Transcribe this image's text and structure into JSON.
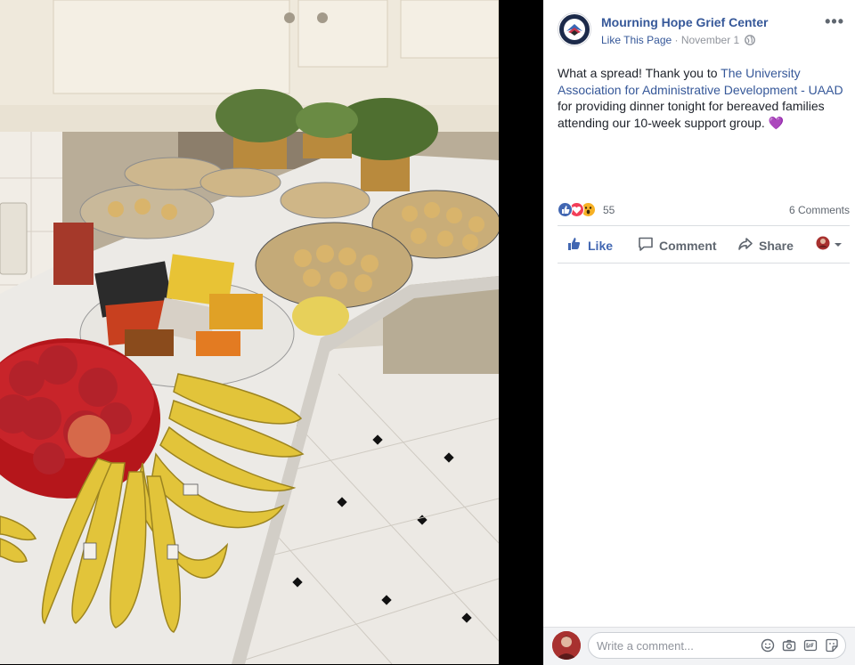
{
  "photo": {
    "alt_icon": "photo-of-food-spread"
  },
  "post": {
    "page_name": "Mourning Hope Grief Center",
    "like_this_page": "Like This Page",
    "separator": " · ",
    "date": "November 1",
    "audience_icon": "globe-icon",
    "more_icon": "•••",
    "text_before_link": "What a spread! Thank you to ",
    "link_text": "The University Association for Administrative Development - UAAD",
    "text_after_link": " for providing dinner tonight for bereaved families attending our 10-week support group. ",
    "emoji": "💜"
  },
  "reactions": {
    "count": "55",
    "comments": "6 Comments",
    "icons": [
      "like-reaction-icon",
      "love-reaction-icon",
      "wow-reaction-icon"
    ]
  },
  "actions": {
    "like": "Like",
    "comment": "Comment",
    "share": "Share"
  },
  "composer": {
    "placeholder": "Write a comment..."
  },
  "colors": {
    "link": "#365899",
    "like_blue": "#4267b2",
    "love_red": "#f33e58",
    "wow_yellow": "#f7b125"
  }
}
